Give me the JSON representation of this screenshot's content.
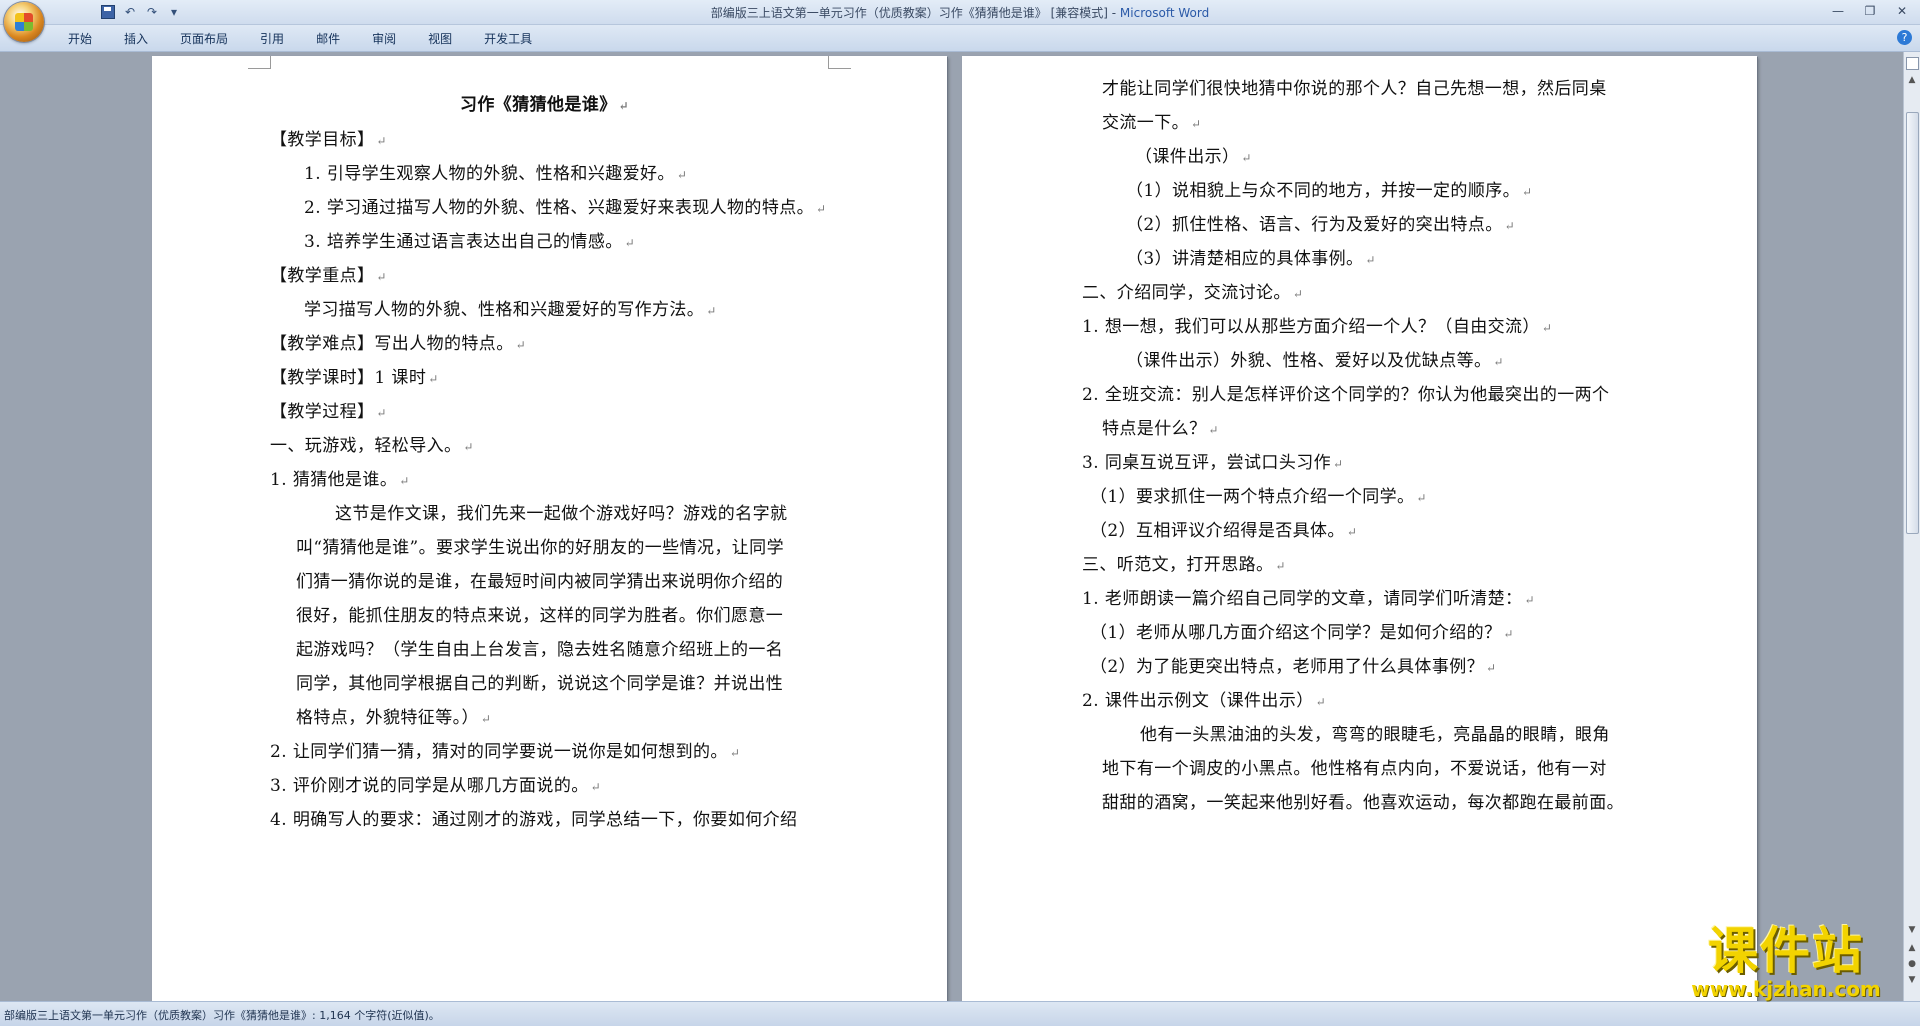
{
  "window": {
    "title": "部编版三上语文第一单元习作（优质教案）习作《猜猜他是谁》 [兼容模式] - ",
    "app_name": "Microsoft Word"
  },
  "ribbon": {
    "tabs": [
      "开始",
      "插入",
      "页面布局",
      "引用",
      "邮件",
      "审阅",
      "视图",
      "开发工具"
    ]
  },
  "colors": {
    "accent": "#2b5aa8",
    "watermark": "#f2d300"
  },
  "pages": {
    "left": [
      "习作《猜猜他是谁》",
      "【教学目标】",
      "1. 引导学生观察人物的外貌、性格和兴趣爱好。",
      "2. 学习通过描写人物的外貌、性格、兴趣爱好来表现人物的特点。",
      "3. 培养学生通过语言表达出自己的情感。",
      "【教学重点】",
      "学习描写人物的外貌、性格和兴趣爱好的写作方法。",
      "【教学难点】写出人物的特点。",
      "【教学课时】1 课时",
      "【教学过程】",
      "一、玩游戏，轻松导入。",
      "1. 猜猜他是谁。",
      "这节是作文课，我们先来一起做个游戏好吗？游戏的名字就",
      "叫“猜猜他是谁”。要求学生说出你的好朋友的一些情况，让同学",
      "们猜一猜你说的是谁，在最短时间内被同学猜出来说明你介绍的",
      "很好，能抓住朋友的特点来说，这样的同学为胜者。你们愿意一",
      "起游戏吗？（学生自由上台发言，隐去姓名随意介绍班上的一名",
      "同学，其他同学根据自己的判断，说说这个同学是谁？并说出性",
      "格特点，外貌特征等。）",
      "2. 让同学们猜一猜，猜对的同学要说一说你是如何想到的。",
      "3. 评价刚才说的同学是从哪几方面说的。",
      "4. 明确写人的要求：通过刚才的游戏，同学总结一下，你要如何介绍"
    ],
    "right": [
      "才能让同学们很快地猜中你说的那个人？自己先想一想，然后同桌",
      "交流一下。",
      "（课件出示）",
      "（1）说相貌上与众不同的地方，并按一定的顺序。",
      "（2）抓住性格、语言、行为及爱好的突出特点。",
      "（3）讲清楚相应的具体事例。",
      "二、介绍同学，交流讨论。",
      "1. 想一想，我们可以从那些方面介绍一个人？（自由交流）",
      "（课件出示）外貌、性格、爱好以及优缺点等。",
      "2. 全班交流：别人是怎样评价这个同学的？你认为他最突出的一两个",
      "特点是什么？",
      "3. 同桌互说互评，尝试口头习作",
      "（1）要求抓住一两个特点介绍一个同学。",
      "（2）互相评议介绍得是否具体。",
      "三、听范文，打开思路。",
      "1. 老师朗读一篇介绍自己同学的文章，请同学们听清楚：",
      "（1）老师从哪几方面介绍这个同学？是如何介绍的？",
      "（2）为了能更突出特点，老师用了什么具体事例？",
      "2. 课件出示例文（课件出示）",
      "他有一头黑油油的头发，弯弯的眼睫毛，亮晶晶的眼睛，眼角",
      "地下有一个调皮的小黑点。他性格有点内向，不爱说话，他有一对",
      "甜甜的酒窝，一笑起来他别好看。他喜欢运动，每次都跑在最前面。"
    ]
  },
  "status_bar": {
    "text": "部编版三上语文第一单元习作（优质教案）习作《猜猜他是谁》: 1,164 个字符(近似值)。"
  },
  "watermark": {
    "cn": "课件站",
    "url": "www.kjzhan.com"
  }
}
